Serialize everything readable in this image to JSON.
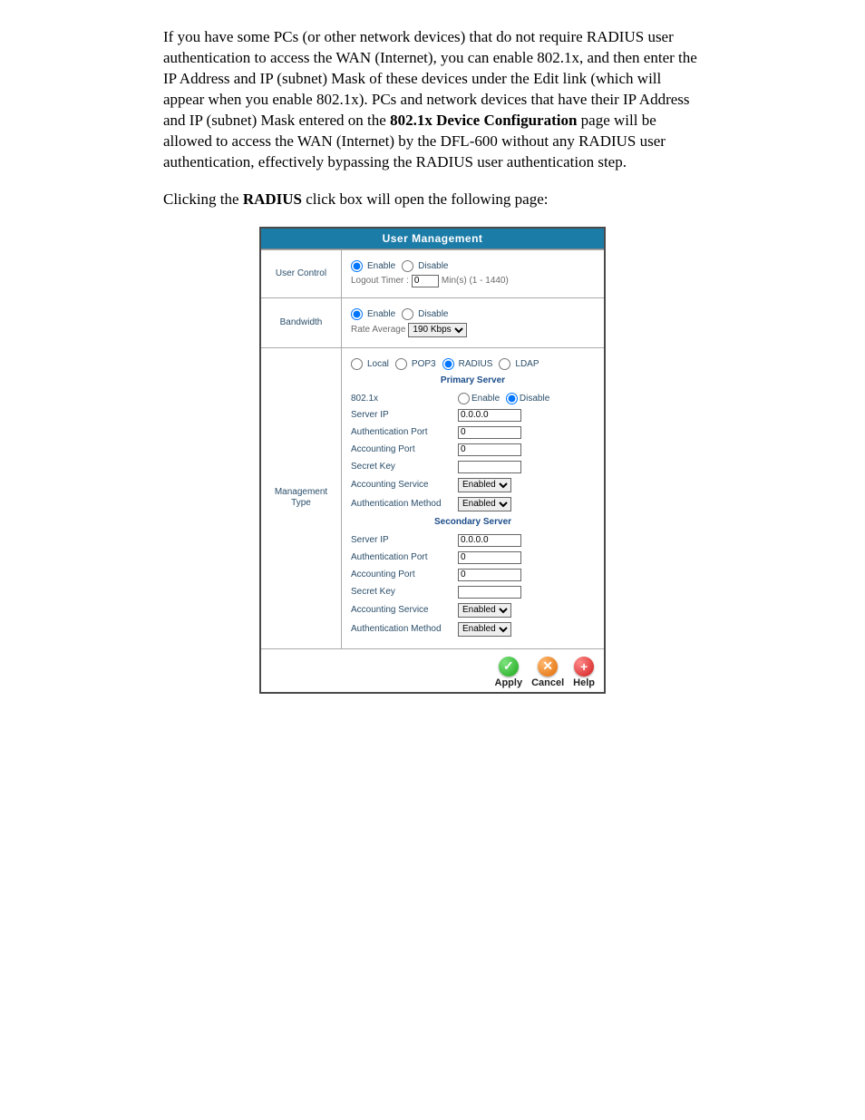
{
  "intro": {
    "p1a": "If you have some PCs (or other network devices) that do not require RADIUS user authentication to access the WAN (Internet), you can enable 802.1x, and then enter the IP Address and IP (subnet) Mask of these devices under the Edit link (which will appear when you enable 802.1x).  PCs and network devices that have their IP Address and IP (subnet) Mask entered on the ",
    "p1bold": "802.1x Device Configuration",
    "p1b": " page will be allowed to access the WAN (Internet) by the DFL-600 without any RADIUS user authentication, effectively bypassing the RADIUS user authentication step.",
    "p2a": "Clicking the ",
    "p2bold": "RADIUS",
    "p2b": " click box will open the following page:"
  },
  "panel": {
    "title": "User Management",
    "userControl": {
      "label": "User Control",
      "enable": "Enable",
      "disable": "Disable",
      "logoutTimerLabel": "Logout Timer :",
      "logoutTimerValue": "0",
      "logoutTimerHint": "Min(s) (1 - 1440)"
    },
    "bandwidth": {
      "label": "Bandwidth",
      "enable": "Enable",
      "disable": "Disable",
      "rateAvgLabel": "Rate Average",
      "rateAvgValue": "190 Kbps"
    },
    "mgmt": {
      "label": "Management Type",
      "opts": {
        "local": "Local",
        "pop3": "POP3",
        "radius": "RADIUS",
        "ldap": "LDAP"
      },
      "primaryHdr": "Primary Server",
      "secondaryHdr": "Secondary Server",
      "x8021": {
        "label": "802.1x",
        "enable": "Enable",
        "disable": "Disable"
      },
      "fields": {
        "serverIp": "Server IP",
        "authPort": "Authentication Port",
        "acctPort": "Accounting Port",
        "secret": "Secret Key",
        "acctSvc": "Accounting Service",
        "authMethod": "Authentication Method"
      },
      "primary": {
        "serverIp": "0.0.0.0",
        "authPort": "0",
        "acctPort": "0",
        "secret": "",
        "acctSvc": "Enabled",
        "authMethod": "Enabled"
      },
      "secondary": {
        "serverIp": "0.0.0.0",
        "authPort": "0",
        "acctPort": "0",
        "secret": "",
        "acctSvc": "Enabled",
        "authMethod": "Enabled"
      }
    },
    "footer": {
      "apply": "Apply",
      "cancel": "Cancel",
      "help": "Help"
    }
  }
}
